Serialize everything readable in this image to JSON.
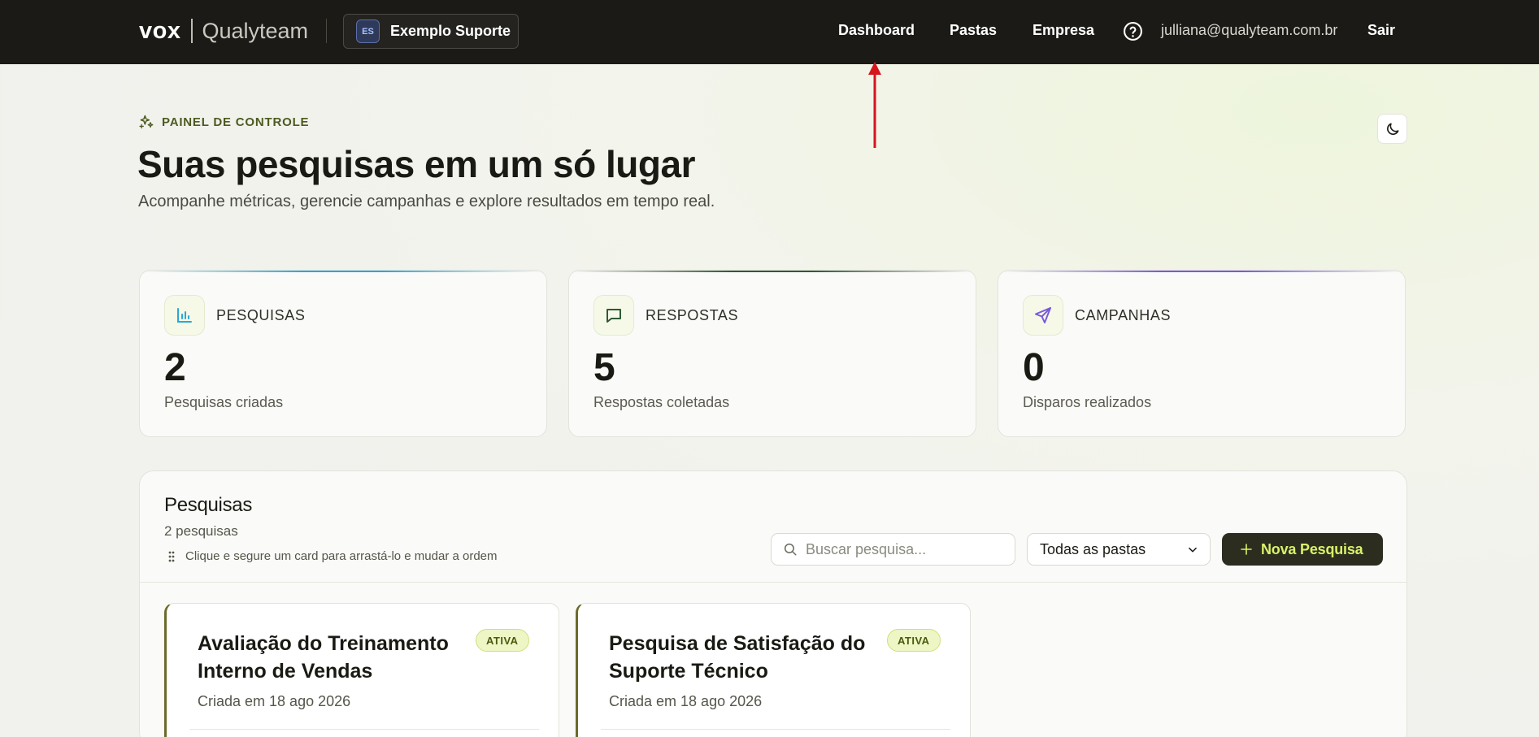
{
  "topbar": {
    "brand_primary": "VOX",
    "brand_secondary": "Qualyteam",
    "workspace": {
      "initials": "ES",
      "name": "Exemplo Suporte"
    },
    "nav": [
      "Dashboard",
      "Pastas",
      "Empresa"
    ],
    "help_icon": "question-circle-icon",
    "user_email": "julliana@qualyteam.com.br",
    "logout_label": "Sair"
  },
  "header": {
    "eyebrow": "PAINEL DE CONTROLE",
    "title": "Suas pesquisas em um só lugar",
    "subtitle": "Acompanhe métricas, gerencie campanhas e explore resultados em tempo real."
  },
  "stats": [
    {
      "label": "PESQUISAS",
      "value": "2",
      "caption": "Pesquisas criadas",
      "icon": "bar-chart-icon",
      "accent": "#29a8d6"
    },
    {
      "label": "RESPOSTAS",
      "value": "5",
      "caption": "Respostas coletadas",
      "icon": "chat-bubble-icon",
      "accent": "#2f5a34"
    },
    {
      "label": "CAMPANHAS",
      "value": "0",
      "caption": "Disparos realizados",
      "icon": "send-icon",
      "accent": "#7a5ad8"
    }
  ],
  "surveys": {
    "title": "Pesquisas",
    "count": "2 pesquisas",
    "hint": "Clique e segure um card para arrastá-lo e mudar a ordem",
    "search_placeholder": "Buscar pesquisa...",
    "folder_filter": "Todas as pastas",
    "new_button": "Nova Pesquisa",
    "items": [
      {
        "title": "Avaliação do Treinamento Interno de Vendas",
        "date": "Criada em 18 ago 2026",
        "status": "ATIVA"
      },
      {
        "title": "Pesquisa de Satisfação do Suporte Técnico",
        "date": "Criada em 18 ago 2026",
        "status": "ATIVA"
      }
    ]
  },
  "colors": {
    "topbar_bg": "#1b1a16",
    "accent_lime": "#d9f26a",
    "button_dark": "#2c2d1e",
    "annotation_arrow": "#d6141e"
  }
}
